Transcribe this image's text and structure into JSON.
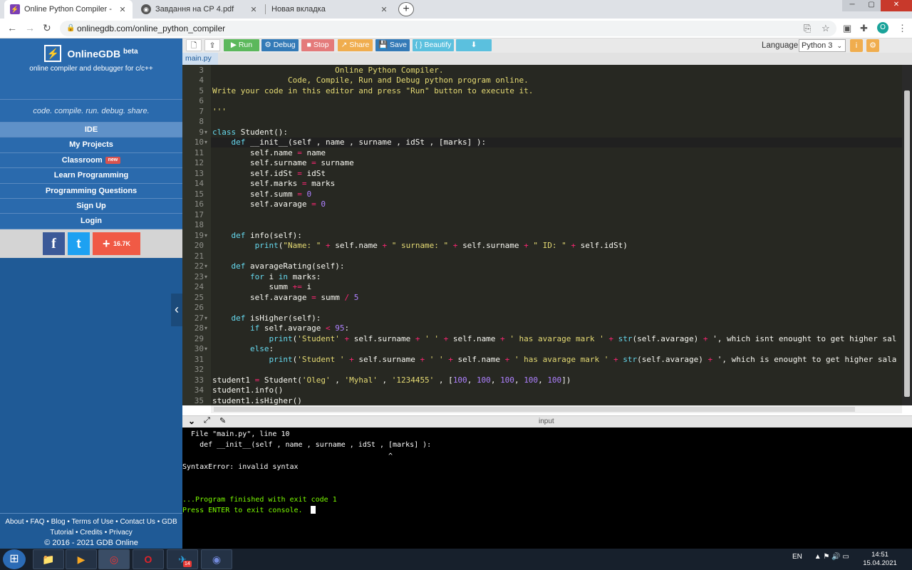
{
  "browser": {
    "tabs": [
      {
        "title": "Online Python Compiler - online",
        "close": "✕",
        "favicon": "⚡",
        "color": "#7b3fb5"
      },
      {
        "title": "Завдання на СР 4.pdf",
        "close": "✕",
        "favicon": "◉",
        "color": "#555"
      },
      {
        "title": "Новая вкладка",
        "close": "✕",
        "favicon": "",
        "color": "#ddd"
      }
    ],
    "new_tab": "+",
    "url": "onlinegdb.com/online_python_compiler",
    "profile_initial": "O",
    "window_controls": [
      "─",
      "▢",
      "✕"
    ]
  },
  "sidebar": {
    "brand_name": "OnlineGDB",
    "brand_beta": "beta",
    "brand_sub": "online compiler and debugger for c/c++",
    "tagline": "code. compile. run. debug. share.",
    "menu": [
      "IDE",
      "My Projects",
      "Classroom",
      "Learn Programming",
      "Programming Questions",
      "Sign Up",
      "Login"
    ],
    "new_badge": "new",
    "social": {
      "facebook": "f",
      "twitter": "t",
      "share_count": "16.7K",
      "share_plus": "+"
    },
    "footer_line1": "About • FAQ • Blog • Terms of Use • Contact Us • GDB",
    "footer_line2": "Tutorial • Credits • Privacy",
    "footer_line3": "© 2016 - 2021 GDB Online",
    "collapse": "‹"
  },
  "toolbar": {
    "new_file": "🗋",
    "upload": "⇪",
    "run": "▶ Run",
    "debug": "⚙ Debug",
    "stop": "■ Stop",
    "share": "↗ Share",
    "save": "💾 Save",
    "beautify": "{ } Beautify",
    "download": "⬇",
    "language_label": "Language",
    "language_value": "Python 3",
    "info_icon": "i",
    "settings_icon": "⚙"
  },
  "file_tab": "main.py",
  "code": {
    "line_numbers": [
      "3",
      "4",
      "5",
      "6",
      "7",
      "8",
      "9",
      "10",
      "11",
      "12",
      "13",
      "14",
      "15",
      "16",
      "17",
      "18",
      "19",
      "20",
      "21",
      "22",
      "23",
      "24",
      "25",
      "26",
      "27",
      "28",
      "29",
      "30",
      "31",
      "32",
      "33",
      "34",
      "35"
    ],
    "lines": [
      "                          Online Python Compiler.",
      "                Code, Compile, Run and Debug python program online.",
      "Write your code in this editor and press \"Run\" button to execute it.",
      "",
      "'''",
      "",
      "class Student():",
      "    def __init__(self , name , surname , idSt , [marks] ):",
      "        self.name = name",
      "        self.surname = surname",
      "        self.idSt = idSt",
      "        self.marks = marks",
      "        self.summ = 0",
      "        self.avarage = 0",
      "",
      "",
      "    def info(self):",
      "         print(\"Name: \" + self.name + \" surname: \" + self.surname + \" ID: \" + self.idSt)",
      "",
      "    def avarageRating(self):",
      "        for i in marks:",
      "            summ += i",
      "        self.avarage = summ / 5",
      "",
      "    def isHigher(self):",
      "        if self.avarage < 95:",
      "            print('Student' + self.surname + ' ' + self.name + ' has avarage mark ' + str(self.avarage) + ', which isnt enought to get higher sal",
      "        else:",
      "            print('Student ' + self.surname + ' ' + self.name + ' has avarage mark ' + str(self.avarage) + ', which is enought to get higher sala",
      "",
      "student1 = Student('Oleg' , 'Myhal' , '1234455' , [100, 100, 100, 100, 100])",
      "student1.info()",
      "student1.isHigher()"
    ],
    "colors": {
      "comment": "#e6db74",
      "keyword": "#66d9ef",
      "text": "#f8f8f2",
      "string": "#a6e22e",
      "number": "#ae81ff",
      "operator": "#f92672"
    }
  },
  "io": {
    "label": "input",
    "toggle_icon": "⌄",
    "expand_icon": "⤢",
    "clear_icon": "✎"
  },
  "console": {
    "lines": [
      {
        "text": "  File \"main.py\", line 10",
        "color": "#ffffff"
      },
      {
        "text": "    def __init__(self , name , surname , idSt , [marks] ):",
        "color": "#ffffff"
      },
      {
        "text": "                                                ^",
        "color": "#ffffff"
      },
      {
        "text": "SyntaxError: invalid syntax",
        "color": "#ffffff"
      },
      {
        "text": "",
        "color": "#ffffff"
      },
      {
        "text": "",
        "color": "#ffffff"
      },
      {
        "text": "...Program finished with exit code 1",
        "color": "#7cfc00"
      },
      {
        "text": "Press ENTER to exit console.",
        "color": "#7cfc00"
      }
    ]
  },
  "taskbar": {
    "start": "⊞",
    "apps": [
      "📁",
      "▶",
      "◎",
      "O",
      "✈",
      "◉"
    ],
    "telegram_badge": "14",
    "lang": "EN",
    "tray_icons": "▲ ⚑ 🔊 ▭",
    "time": "14:51",
    "date": "15.04.2021"
  }
}
